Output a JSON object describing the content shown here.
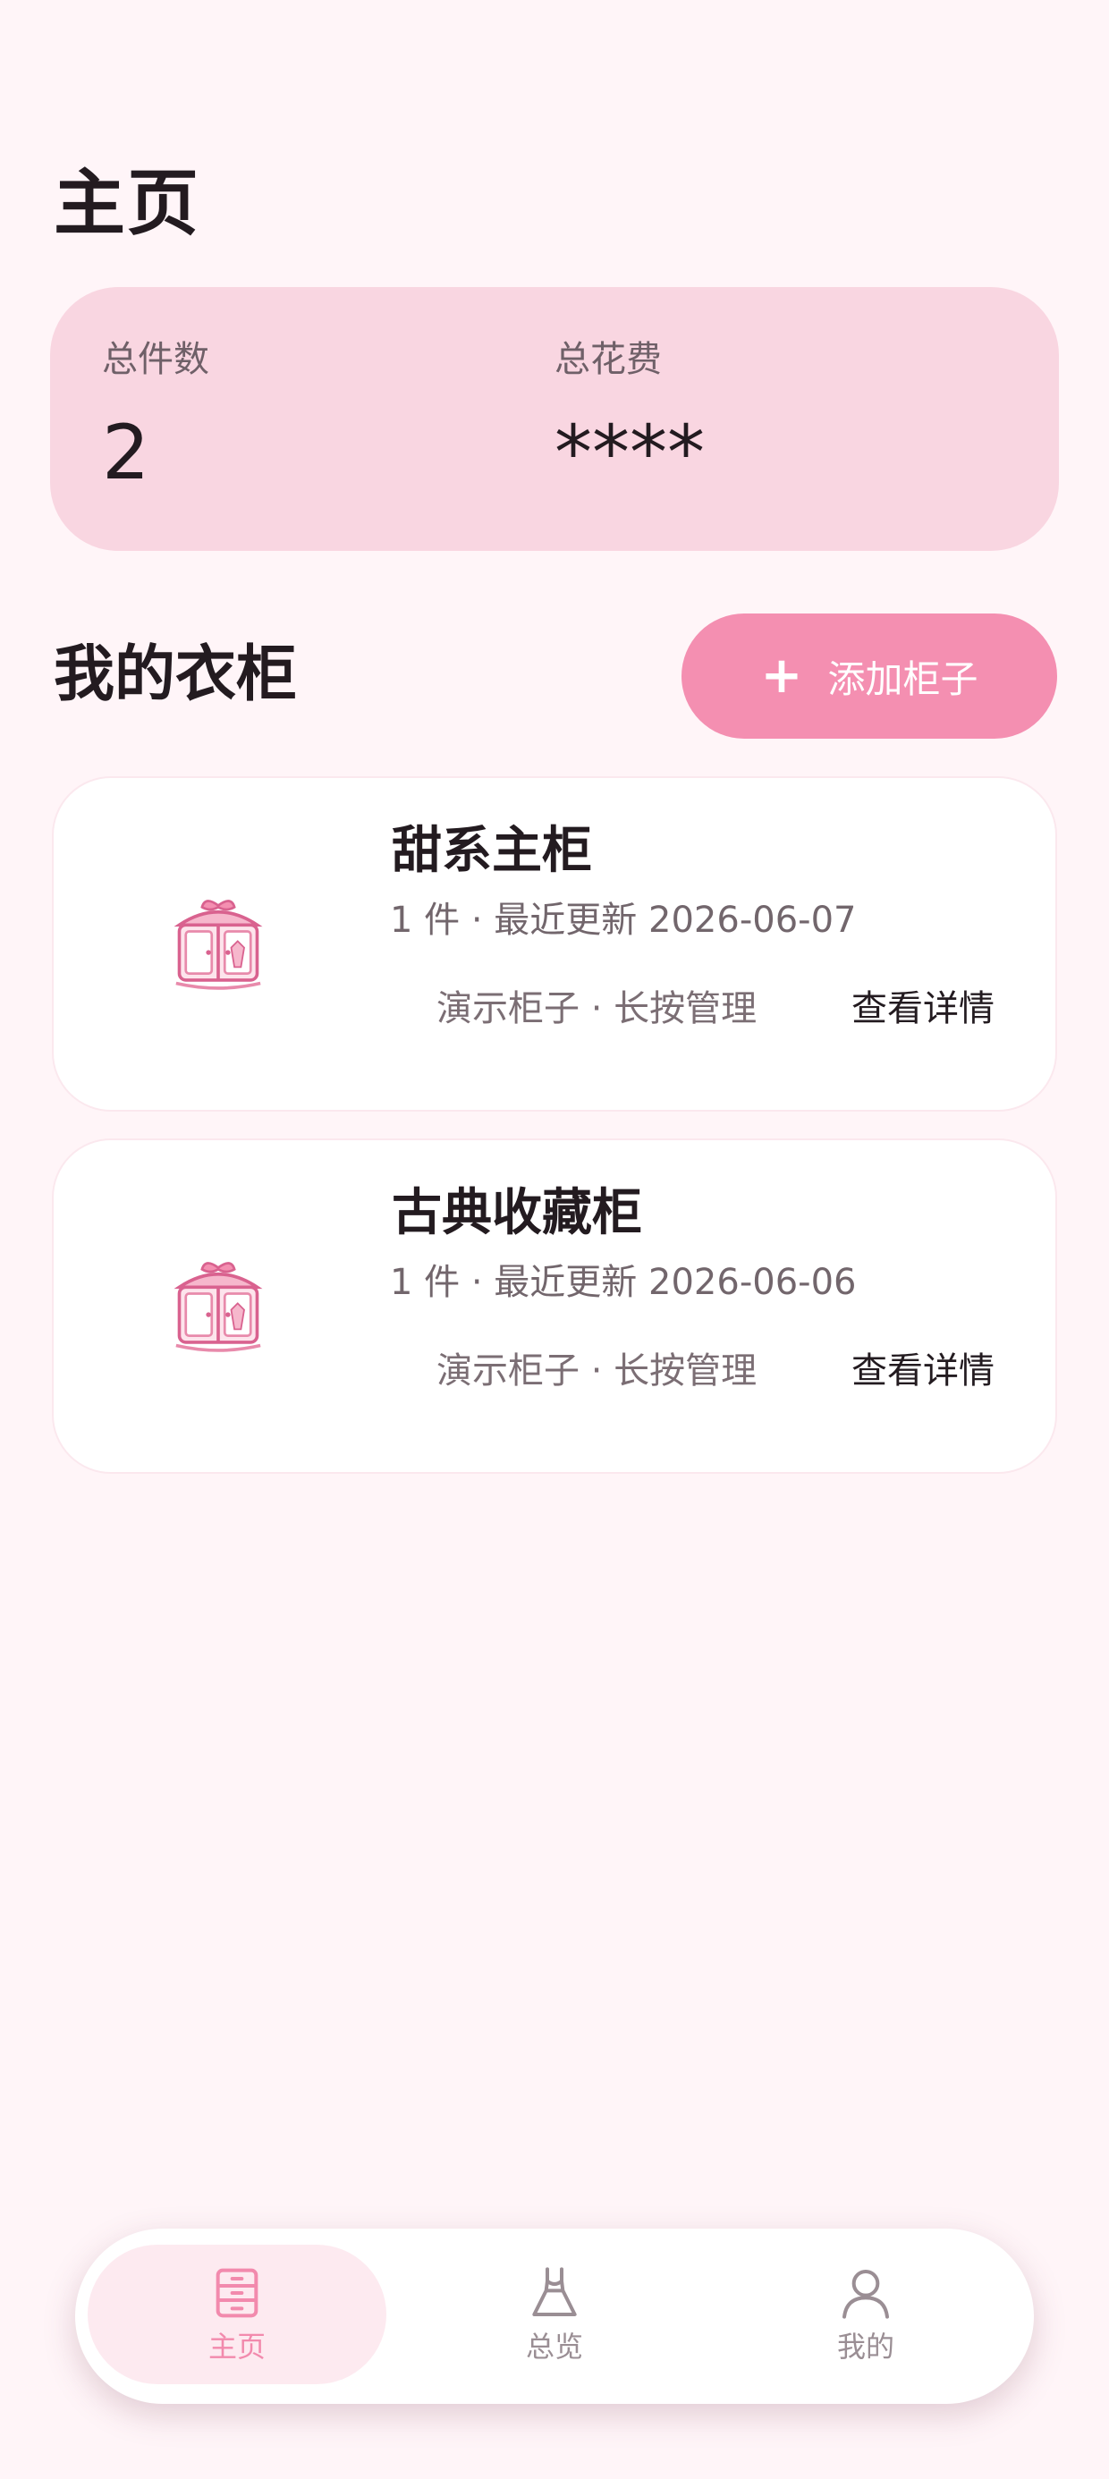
{
  "header": {
    "title": "主页"
  },
  "stats": {
    "total_items_label": "总件数",
    "total_items_value": "2",
    "total_cost_label": "总花费",
    "total_cost_value": "****"
  },
  "wardrobe": {
    "title": "我的衣柜",
    "add_button_label": "添加柜子",
    "cabinets": [
      {
        "name": "甜系主柜",
        "meta": "1 件 · 最近更新 2026-06-07",
        "hint": "演示柜子 · 长按管理",
        "detail_label": "查看详情"
      },
      {
        "name": "古典收藏柜",
        "meta": "1 件 · 最近更新 2026-06-06",
        "hint": "演示柜子 · 长按管理",
        "detail_label": "查看详情"
      }
    ]
  },
  "bottom_nav": {
    "items": [
      {
        "label": "主页",
        "icon": "drawer-icon",
        "active": true
      },
      {
        "label": "总览",
        "icon": "dress-icon",
        "active": false
      },
      {
        "label": "我的",
        "icon": "person-icon",
        "active": false
      }
    ]
  },
  "colors": {
    "background": "#fff5f8",
    "card_pink": "#f9d6e1",
    "accent": "#f48fb1",
    "nav_active_bg": "#fdeaf0",
    "nav_active_text": "#f28aad",
    "nav_inactive_text": "#9a8e94"
  }
}
